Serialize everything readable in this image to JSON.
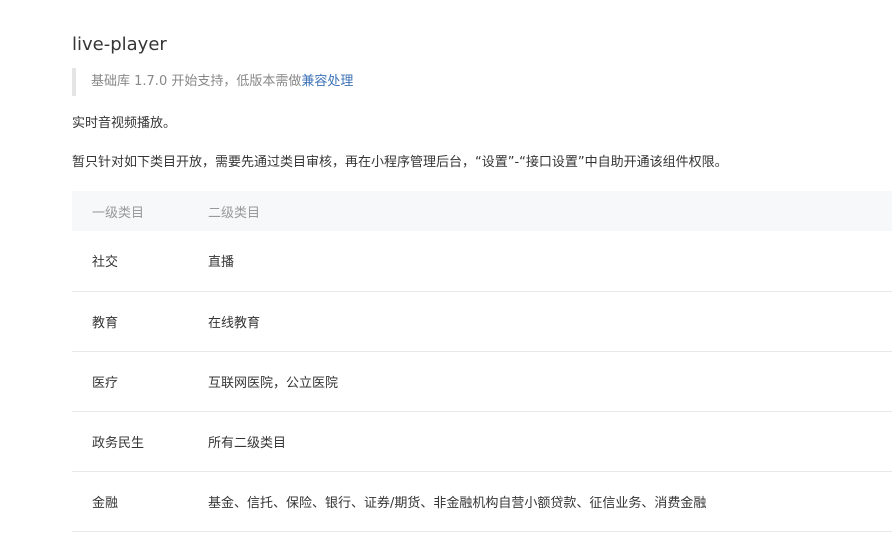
{
  "page": {
    "title": "live-player",
    "note": {
      "text": "基础库 1.7.0 开始支持，低版本需做",
      "link_label": "兼容处理"
    },
    "description": "实时音视频播放。",
    "restriction": "暂只针对如下类目开放，需要先通过类目审核，再在小程序管理后台，“设置”-“接口设置”中自助开通该组件权限。"
  },
  "table": {
    "headers": [
      "一级类目",
      "二级类目"
    ],
    "rows": [
      {
        "level1": "社交",
        "level2": "直播"
      },
      {
        "level1": "教育",
        "level2": "在线教育"
      },
      {
        "level1": "医疗",
        "level2": "互联网医院，公立医院"
      },
      {
        "level1": "政务民生",
        "level2": "所有二级类目"
      },
      {
        "level1": "金融",
        "level2": "基金、信托、保险、银行、证券/期货、非金融机构自营小额贷款、征信业务、消费金融"
      }
    ]
  },
  "colors": {
    "link": "#3c72b8",
    "header_bg": "#f7f8fa",
    "muted_text": "#888888"
  }
}
